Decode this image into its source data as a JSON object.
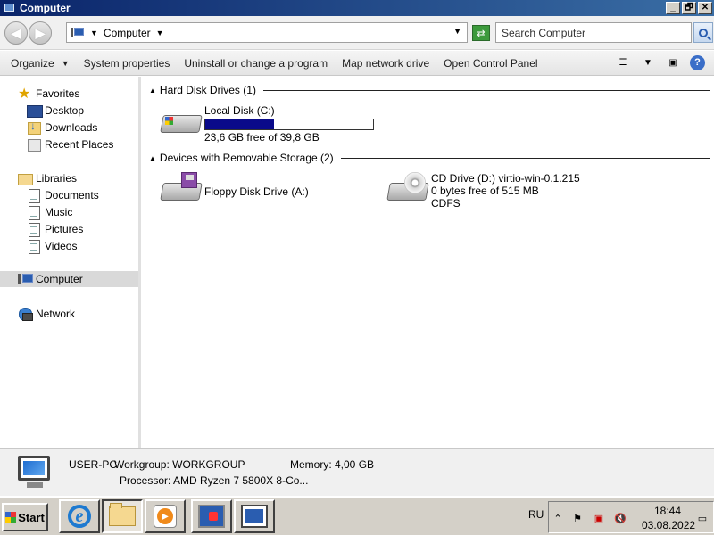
{
  "window": {
    "title": "Computer",
    "buttons": {
      "minimize": "_",
      "maximize": "🗗",
      "close": "✕"
    }
  },
  "address": {
    "path": "Computer",
    "search_placeholder": "Search Computer"
  },
  "toolbar": {
    "organize": "Organize",
    "system_properties": "System properties",
    "uninstall": "Uninstall or change a program",
    "map_drive": "Map network drive",
    "control_panel": "Open Control Panel"
  },
  "nav": {
    "favorites": "Favorites",
    "desktop": "Desktop",
    "downloads": "Downloads",
    "recent": "Recent Places",
    "libraries": "Libraries",
    "documents": "Documents",
    "music": "Music",
    "pictures": "Pictures",
    "videos": "Videos",
    "computer": "Computer",
    "network": "Network"
  },
  "content": {
    "hdd_group": "Hard Disk Drives (1)",
    "removable_group": "Devices with Removable Storage (2)",
    "local_disk": {
      "name": "Local Disk (C:)",
      "free": "23,6 GB free of 39,8 GB",
      "used_fraction": 0.407
    },
    "floppy": {
      "name": "Floppy Disk Drive (A:)"
    },
    "cd": {
      "name": "CD Drive (D:) virtio-win-0.1.215",
      "free": "0 bytes free of 515 MB",
      "fs": "CDFS"
    }
  },
  "details": {
    "pc_name": "USER-PC",
    "workgroup_label": "Workgroup: WORKGROUP",
    "memory": "Memory: 4,00 GB",
    "processor": "Processor: AMD Ryzen 7 5800X 8-Co..."
  },
  "taskbar": {
    "start": "Start",
    "lang": "RU",
    "time": "18:44",
    "date": "03.08.2022"
  },
  "colors": {
    "title_bar": "#0a246a",
    "disk_fill": "#0a0a8a"
  }
}
